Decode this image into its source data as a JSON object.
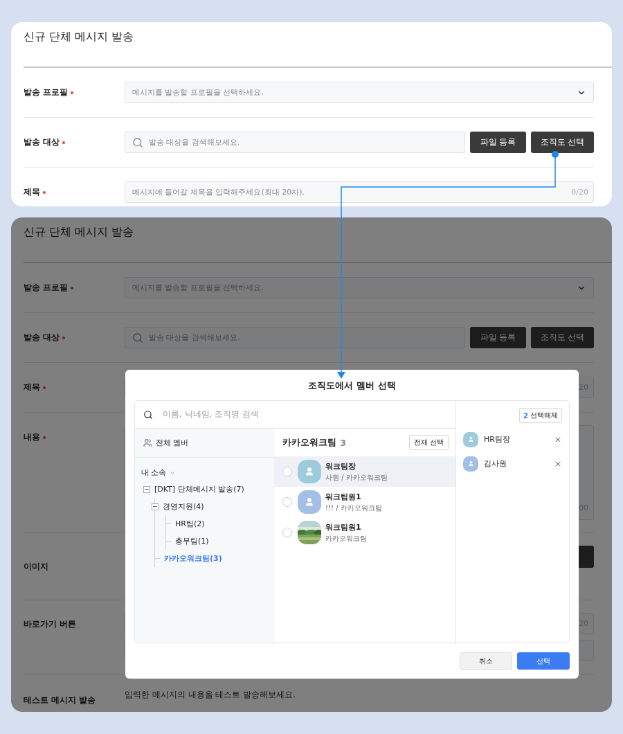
{
  "top_panel": {
    "title": "신규 단체 메시지 발송",
    "rows": [
      {
        "kind": "select",
        "label": "발송 프로필",
        "required": true,
        "placeholder": "메시지를 발송할 프로필을 선택하세요."
      },
      {
        "kind": "search",
        "label": "발송 대상",
        "required": true,
        "placeholder": "발송 대상을 검색해보세요.",
        "buttons": [
          "파일 등록",
          "조직도 선택"
        ]
      },
      {
        "kind": "text",
        "label": "제목",
        "required": true,
        "placeholder": "메시지에 들어갈 제목을 입력해주세요(최대 20자).",
        "counter": "0/20"
      }
    ]
  },
  "bottom_panel": {
    "title": "신규 단체 메시지 발송",
    "rows": [
      {
        "kind": "select",
        "label": "발송 프로필",
        "required": true,
        "placeholder": "메시지를 발송할 프로필을 선택하세요."
      },
      {
        "kind": "search",
        "label": "발송 대상",
        "required": true,
        "placeholder": "발송 대상을 검색해보세요.",
        "buttons": [
          "파일 등록",
          "조직도 선택"
        ]
      },
      {
        "kind": "text",
        "label": "제목",
        "required": true,
        "counter": "20"
      },
      {
        "kind": "textarea",
        "label": "내용",
        "required": true,
        "counter": "00"
      },
      {
        "label": "이미지",
        "required": false
      },
      {
        "kind": "link",
        "label": "바로가기 버튼",
        "required": false,
        "counter": "20"
      },
      {
        "kind": "test",
        "label": "테스트 메시지 발송",
        "required": false,
        "description": "입력한 메시지의 내용을 테스트 발송해보세요."
      }
    ],
    "modal": {
      "title": "조직도에서 멤버 선택",
      "search": {
        "placeholder": "이름, 닉네임, 조직명 검색"
      },
      "all_members": "전체 멤버",
      "group_label": "내 소속",
      "tree": [
        {
          "label": "[DKT] 단체메시지 발송(7)",
          "expanded": true,
          "selected": false,
          "children": [
            {
              "label": "경영지원(4)",
              "expanded": true,
              "selected": false,
              "children": [
                {
                  "label": "HR팀(2)",
                  "selected": false
                },
                {
                  "label": "총무팀(1)",
                  "selected": false
                }
              ]
            },
            {
              "label": "카카오워크팀(3)",
              "selected": true
            }
          ]
        }
      ],
      "team": {
        "name": "카카오워크팀",
        "count": "3",
        "select_all": "전체 선택",
        "members": [
          {
            "name": "워크팀장",
            "detail": "사원 / 카카오워크팀",
            "kind": "default",
            "color": "#9ecbdb",
            "selected": true,
            "checked": false
          },
          {
            "name": "워크팀원1",
            "detail": "!!! / 카카오워크팀",
            "kind": "default",
            "color": "#a3bfe6",
            "selected": false,
            "checked": false
          },
          {
            "name": "워크팀원1",
            "detail": "카카오워크팀",
            "kind": "picture",
            "selected": false,
            "checked": false
          }
        ]
      },
      "selection": {
        "count": "2",
        "clear": "선택해제",
        "items": [
          {
            "name": "HR팀장",
            "color": "#9ecbdb"
          },
          {
            "name": "김사원",
            "color": "#a3bfe6"
          }
        ]
      },
      "buttons": [
        {
          "label": "취소",
          "kind": "secondary"
        },
        {
          "label": "선택",
          "kind": "primary"
        }
      ]
    }
  }
}
